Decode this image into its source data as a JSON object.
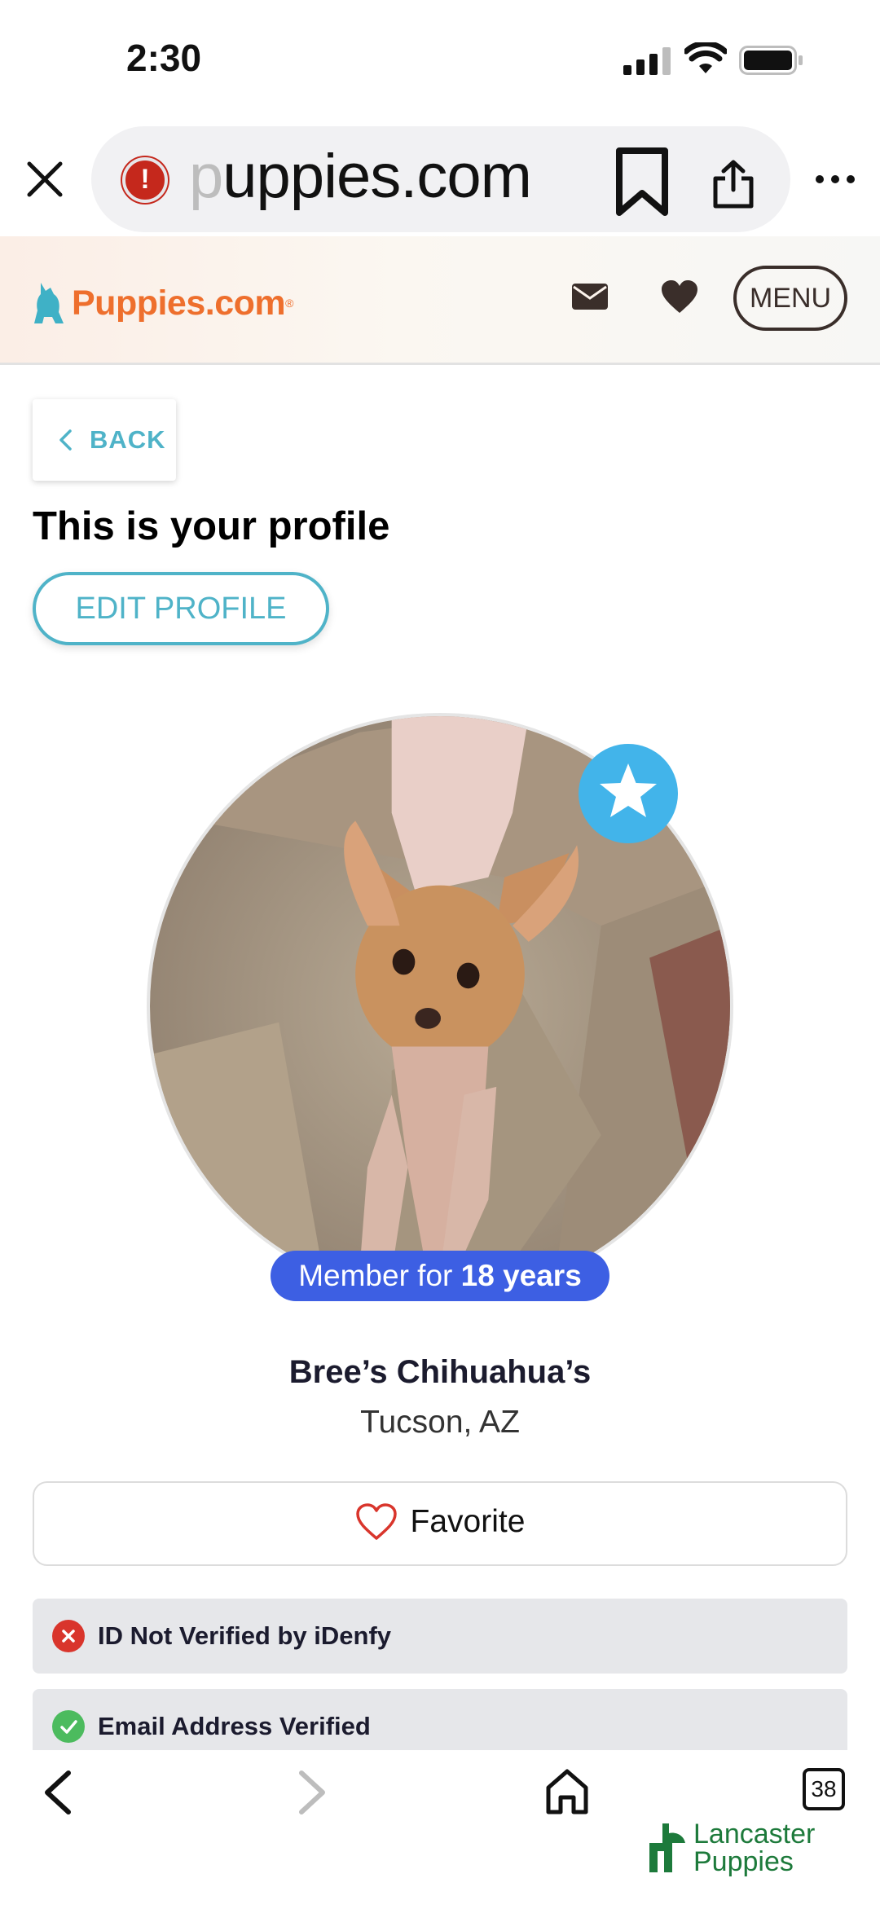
{
  "status_bar": {
    "time": "2:30"
  },
  "browser": {
    "url_faded": "p",
    "url_rest": "uppies.com",
    "tab_count": "38"
  },
  "site": {
    "logo_text": "Puppies.com",
    "logo_reg": "®",
    "menu_label": "MENU",
    "brand_color": "#ee6f2d",
    "accent_color": "#4fb3c8"
  },
  "page": {
    "back_label": "BACK",
    "heading": "This is your profile",
    "edit_profile_label": "EDIT PROFILE",
    "member_prefix": "Member for ",
    "member_duration": "18 years",
    "breeder_name": "Bree’s Chihuahua’s",
    "location": "Tucson, AZ",
    "favorite_label": "Favorite",
    "verifications": [
      {
        "label": "ID Not Verified by iDenfy",
        "status": "not-verified",
        "color": "#d9352c"
      },
      {
        "label": "Email Address Verified",
        "status": "verified",
        "color": "#4cbb5e"
      }
    ]
  },
  "footer_brand": {
    "line1": "Lancaster",
    "line2": "Puppies"
  }
}
